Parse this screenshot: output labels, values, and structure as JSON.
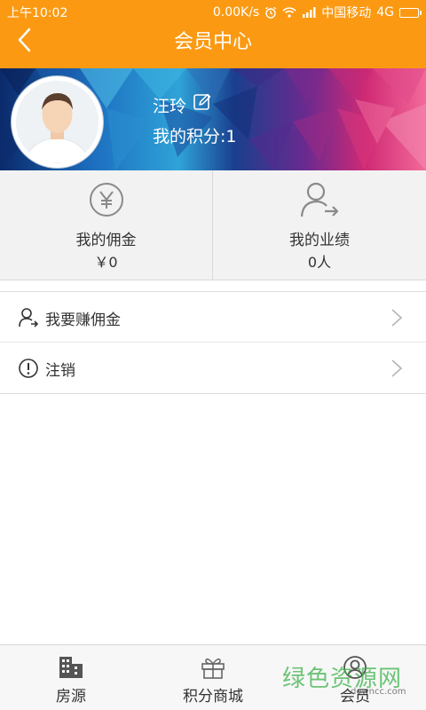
{
  "status_bar": {
    "time": "上午10:02",
    "speed": "0.00K/s",
    "carrier": "中国移动",
    "network": "4G"
  },
  "nav": {
    "title": "会员中心",
    "back_icon": "chevron-left-icon"
  },
  "profile": {
    "name": "汪玲",
    "points_label": "我的积分:1"
  },
  "stats": [
    {
      "icon": "yen-circle-icon",
      "label": "我的佣金",
      "value": "￥0"
    },
    {
      "icon": "user-arrow-icon",
      "label": "我的业绩",
      "value": "0人"
    }
  ],
  "menu": [
    {
      "icon": "user-arrow-icon",
      "label": "我要赚佣金"
    },
    {
      "icon": "exclamation-circle-icon",
      "label": "注销"
    }
  ],
  "tabs": [
    {
      "icon": "building-icon",
      "label": "房源"
    },
    {
      "icon": "gift-icon",
      "label": "积分商城"
    },
    {
      "icon": "user-circle-icon",
      "label": "会员"
    }
  ],
  "watermark": {
    "text": "绿色资源网",
    "sub": "downcc.com"
  },
  "colors": {
    "header": "#fb9a12",
    "background": "#ffffff",
    "stats_background": "#f2f2f2"
  }
}
